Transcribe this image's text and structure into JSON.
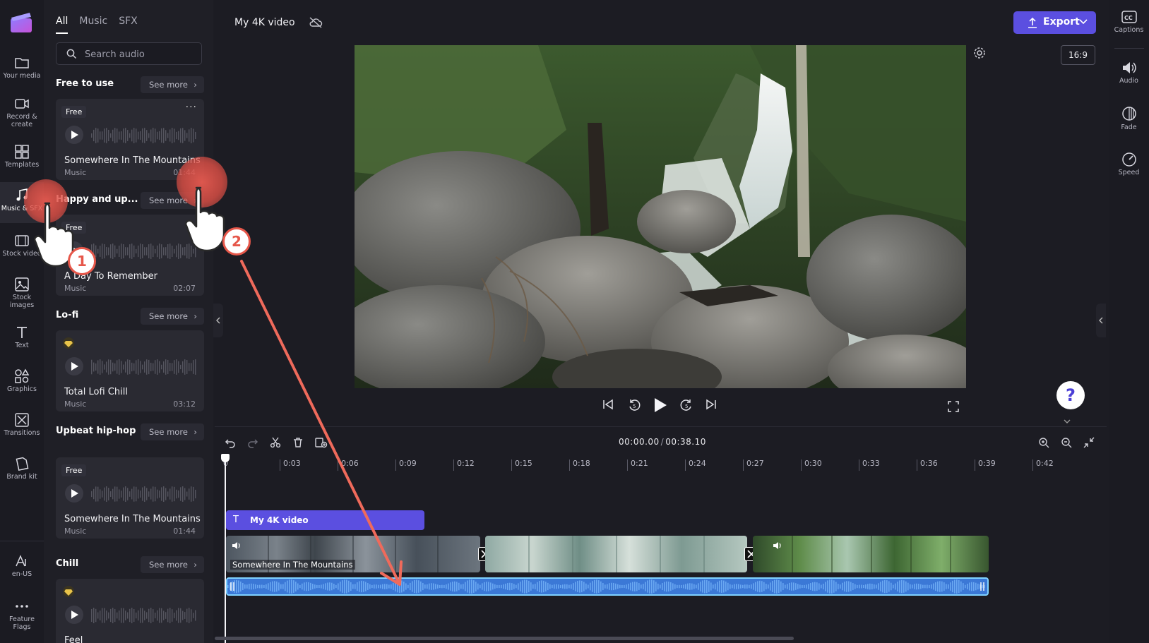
{
  "nav": {
    "items": [
      {
        "label": "Your media",
        "icon": "folder-icon"
      },
      {
        "label": "Record &\ncreate",
        "icon": "camera-icon"
      },
      {
        "label": "Templates",
        "icon": "templates-icon"
      },
      {
        "label": "Music & SFX",
        "icon": "music-note-icon",
        "active": true
      },
      {
        "label": "Stock video",
        "icon": "film-icon"
      },
      {
        "label": "Stock\nimages",
        "icon": "image-icon"
      },
      {
        "label": "Text",
        "icon": "text-icon"
      },
      {
        "label": "Graphics",
        "icon": "shapes-icon"
      },
      {
        "label": "Transitions",
        "icon": "transitions-icon"
      },
      {
        "label": "Brand kit",
        "icon": "brand-kit-icon"
      }
    ],
    "bottom": [
      {
        "label": "en-US",
        "icon": "language-icon"
      },
      {
        "label": "Feature\nFlags",
        "icon": "ellipsis-icon"
      }
    ]
  },
  "audio_panel": {
    "tabs": [
      "All",
      "Music",
      "SFX"
    ],
    "active_tab": "All",
    "search_placeholder": "Search audio",
    "see_more_label": "See more",
    "sections": [
      {
        "title": "Free to use",
        "card": {
          "badge": "Free",
          "title": "Somewhere In The Mountains",
          "kind": "Music",
          "duration": "01:44"
        }
      },
      {
        "title": "Happy and up...",
        "card": {
          "badge": "Free",
          "title": "A Day To Remember",
          "kind": "Music",
          "duration": "02:07"
        }
      },
      {
        "title": "Lo-fi",
        "card": {
          "badge": "premium",
          "title": "Total Lofi Chill",
          "kind": "Music",
          "duration": "03:12"
        }
      },
      {
        "title": "Upbeat hip-hop",
        "card": {
          "badge": "Free",
          "title": "Somewhere In The Mountains",
          "kind": "Music",
          "duration": "01:44"
        }
      },
      {
        "title": "Chill",
        "card": {
          "badge": "premium",
          "title": "Feel",
          "kind": "",
          "duration": ""
        }
      }
    ]
  },
  "header": {
    "project_title": "My 4K video",
    "export_label": "Export"
  },
  "preview": {
    "aspect_ratio": "16:9",
    "help": "?"
  },
  "right_panel": [
    {
      "label": "Captions",
      "icon": "captions-icon"
    },
    {
      "label": "Audio",
      "icon": "speaker-icon"
    },
    {
      "label": "Fade",
      "icon": "fade-icon"
    },
    {
      "label": "Speed",
      "icon": "speed-icon"
    }
  ],
  "timeline": {
    "current_time": "00:00.00",
    "total_time": "00:38.10",
    "ruler": [
      "0",
      "0:03",
      "0:06",
      "0:09",
      "0:12",
      "0:15",
      "0:18",
      "0:21",
      "0:24",
      "0:27",
      "0:30",
      "0:33",
      "0:36",
      "0:39",
      "0:42"
    ],
    "text_clip": "My 4K video",
    "audio_clip_label": "Somewhere In The Mountains"
  },
  "tutorial": {
    "steps": [
      "1",
      "2"
    ]
  },
  "colors": {
    "accent": "#5b4fe0",
    "audio_track": "#3b78d6",
    "tutorial": "#e6574a"
  }
}
